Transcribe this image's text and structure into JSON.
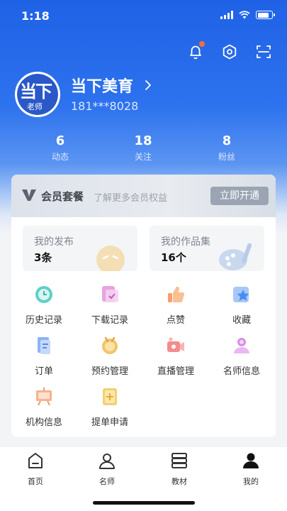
{
  "status_bar": {
    "time": "1:18"
  },
  "profile": {
    "avatar_tag": "老师",
    "avatar_text": "当下",
    "name": "当下美育",
    "phone": "181***8028"
  },
  "stats": [
    {
      "value": "6",
      "label": "动态"
    },
    {
      "value": "18",
      "label": "关注"
    },
    {
      "value": "8",
      "label": "粉丝"
    }
  ],
  "membership": {
    "title": "会员套餐",
    "subtitle": "了解更多会员权益",
    "button": "立即开通"
  },
  "boxes": [
    {
      "title": "我的发布",
      "value": "3条"
    },
    {
      "title": "我的作品集",
      "value": "16个"
    }
  ],
  "grid": [
    {
      "label": "历史记录",
      "icon": "history-icon"
    },
    {
      "label": "下载记录",
      "icon": "download-icon"
    },
    {
      "label": "点赞",
      "icon": "thumbs-up-icon"
    },
    {
      "label": "收藏",
      "icon": "star-icon"
    },
    {
      "label": "订单",
      "icon": "order-icon"
    },
    {
      "label": "预约管理",
      "icon": "appointment-icon"
    },
    {
      "label": "直播管理",
      "icon": "live-camera-icon"
    },
    {
      "label": "名师信息",
      "icon": "teacher-icon"
    },
    {
      "label": "机构信息",
      "icon": "institution-icon"
    },
    {
      "label": "提单申请",
      "icon": "application-icon"
    }
  ],
  "tabs": [
    {
      "label": "首页",
      "icon": "home-icon"
    },
    {
      "label": "名师",
      "icon": "teacher-tab-icon"
    },
    {
      "label": "教材",
      "icon": "books-icon"
    },
    {
      "label": "我的",
      "icon": "profile-icon",
      "active": true
    }
  ],
  "colors": {
    "primary": "#1f62e6",
    "notify": "#ff6a3d"
  }
}
